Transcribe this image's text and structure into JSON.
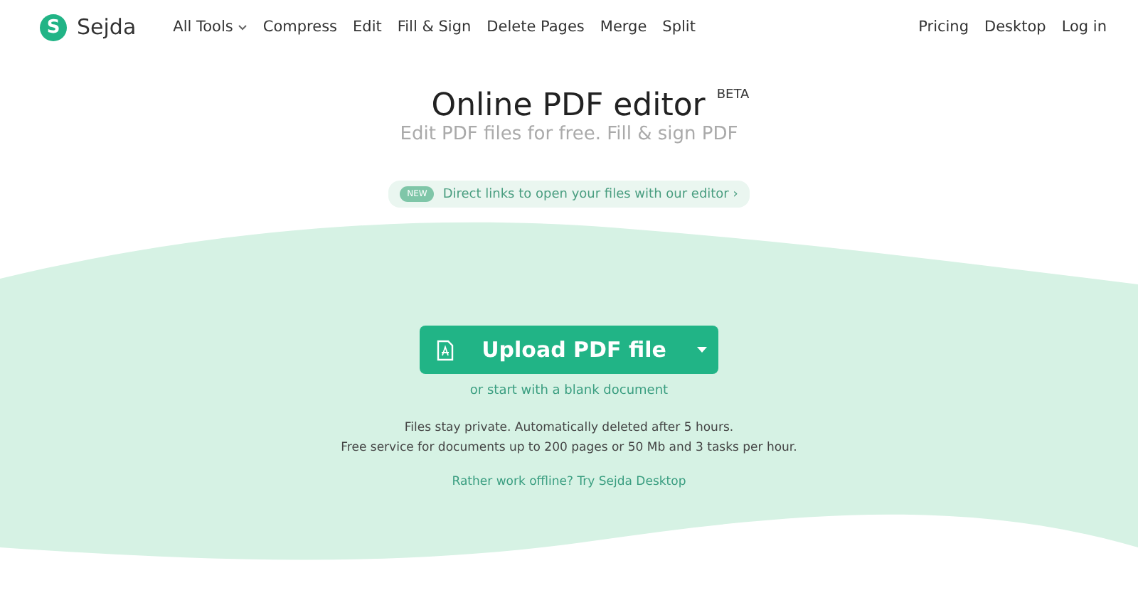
{
  "nav": {
    "brand": "Sejda",
    "logo_letter": "S",
    "items": [
      {
        "label": "All Tools",
        "dropdown": true
      },
      {
        "label": "Compress",
        "dropdown": false
      },
      {
        "label": "Edit",
        "dropdown": false
      },
      {
        "label": "Fill & Sign",
        "dropdown": false
      },
      {
        "label": "Delete Pages",
        "dropdown": false
      },
      {
        "label": "Merge",
        "dropdown": false
      },
      {
        "label": "Split",
        "dropdown": false
      }
    ],
    "right_items": [
      "Pricing",
      "Desktop",
      "Log in"
    ]
  },
  "hero": {
    "title": "Online PDF editor",
    "title_badge": "BETA",
    "subtitle": "Edit PDF files for free. Fill & sign PDF",
    "notice": {
      "badge": "NEW",
      "text": "Direct links to open your files with our editor",
      "chevron": "›"
    }
  },
  "upload": {
    "button": "Upload PDF file",
    "blank_link": "or start with a blank document",
    "info": [
      "Files stay private. Automatically deleted after 5 hours.",
      "Free service for documents up to 200 pages or 50 Mb and 3 tasks per hour."
    ],
    "offline_link": "Rather work offline? Try Sejda Desktop"
  }
}
